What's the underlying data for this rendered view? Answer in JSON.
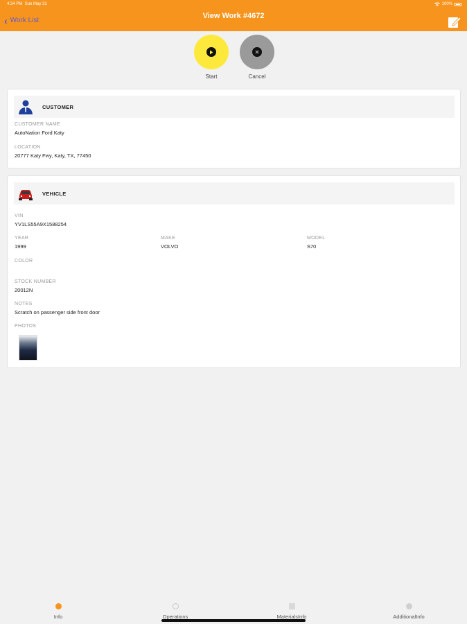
{
  "status_bar": {
    "time": "4:34 PM",
    "date": "Sun May 31",
    "wifi_icon": "wifi-icon",
    "battery": "100%"
  },
  "nav": {
    "back_label": "Work List",
    "title": "View Work #4672",
    "edit_icon": "edit-icon"
  },
  "actions": {
    "start": {
      "label": "Start",
      "icon": "play-icon",
      "color": "#fde93b"
    },
    "cancel": {
      "label": "Cancel",
      "icon": "close-icon",
      "color": "#9a9a9a"
    }
  },
  "customer": {
    "section_title": "CUSTOMER",
    "icon": "customer-icon",
    "name_label": "CUSTOMER NAME",
    "name": "AutoNation Ford Katy",
    "location_label": "LOCATION",
    "location": "20777 Katy Fwy, Katy, TX, 77450"
  },
  "vehicle": {
    "section_title": "VEHICLE",
    "icon": "car-icon",
    "vin_label": "VIN",
    "vin": "YV1LS55A9X1588254",
    "year_label": "YEAR",
    "year": "1999",
    "make_label": "MAKE",
    "make": "VOLVO",
    "model_label": "MODEL",
    "model": "S70",
    "color_label": "COLOR",
    "color": "",
    "stock_label": "STOCK NUMBER",
    "stock": "20012N",
    "notes_label": "NOTES",
    "notes": "Scratch on passenger side front door",
    "photos_label": "PHOTOS"
  },
  "tabs": [
    {
      "label": "Info",
      "icon": "info-icon",
      "active": true
    },
    {
      "label": "Operations",
      "icon": "operations-icon",
      "active": false
    },
    {
      "label": "MaterialsInfo",
      "icon": "materials-icon",
      "active": false
    },
    {
      "label": "AdditionalInfo",
      "icon": "additional-info-icon",
      "active": false
    }
  ],
  "colors": {
    "accent": "#f7941d",
    "back_link": "#5a5ad6"
  }
}
